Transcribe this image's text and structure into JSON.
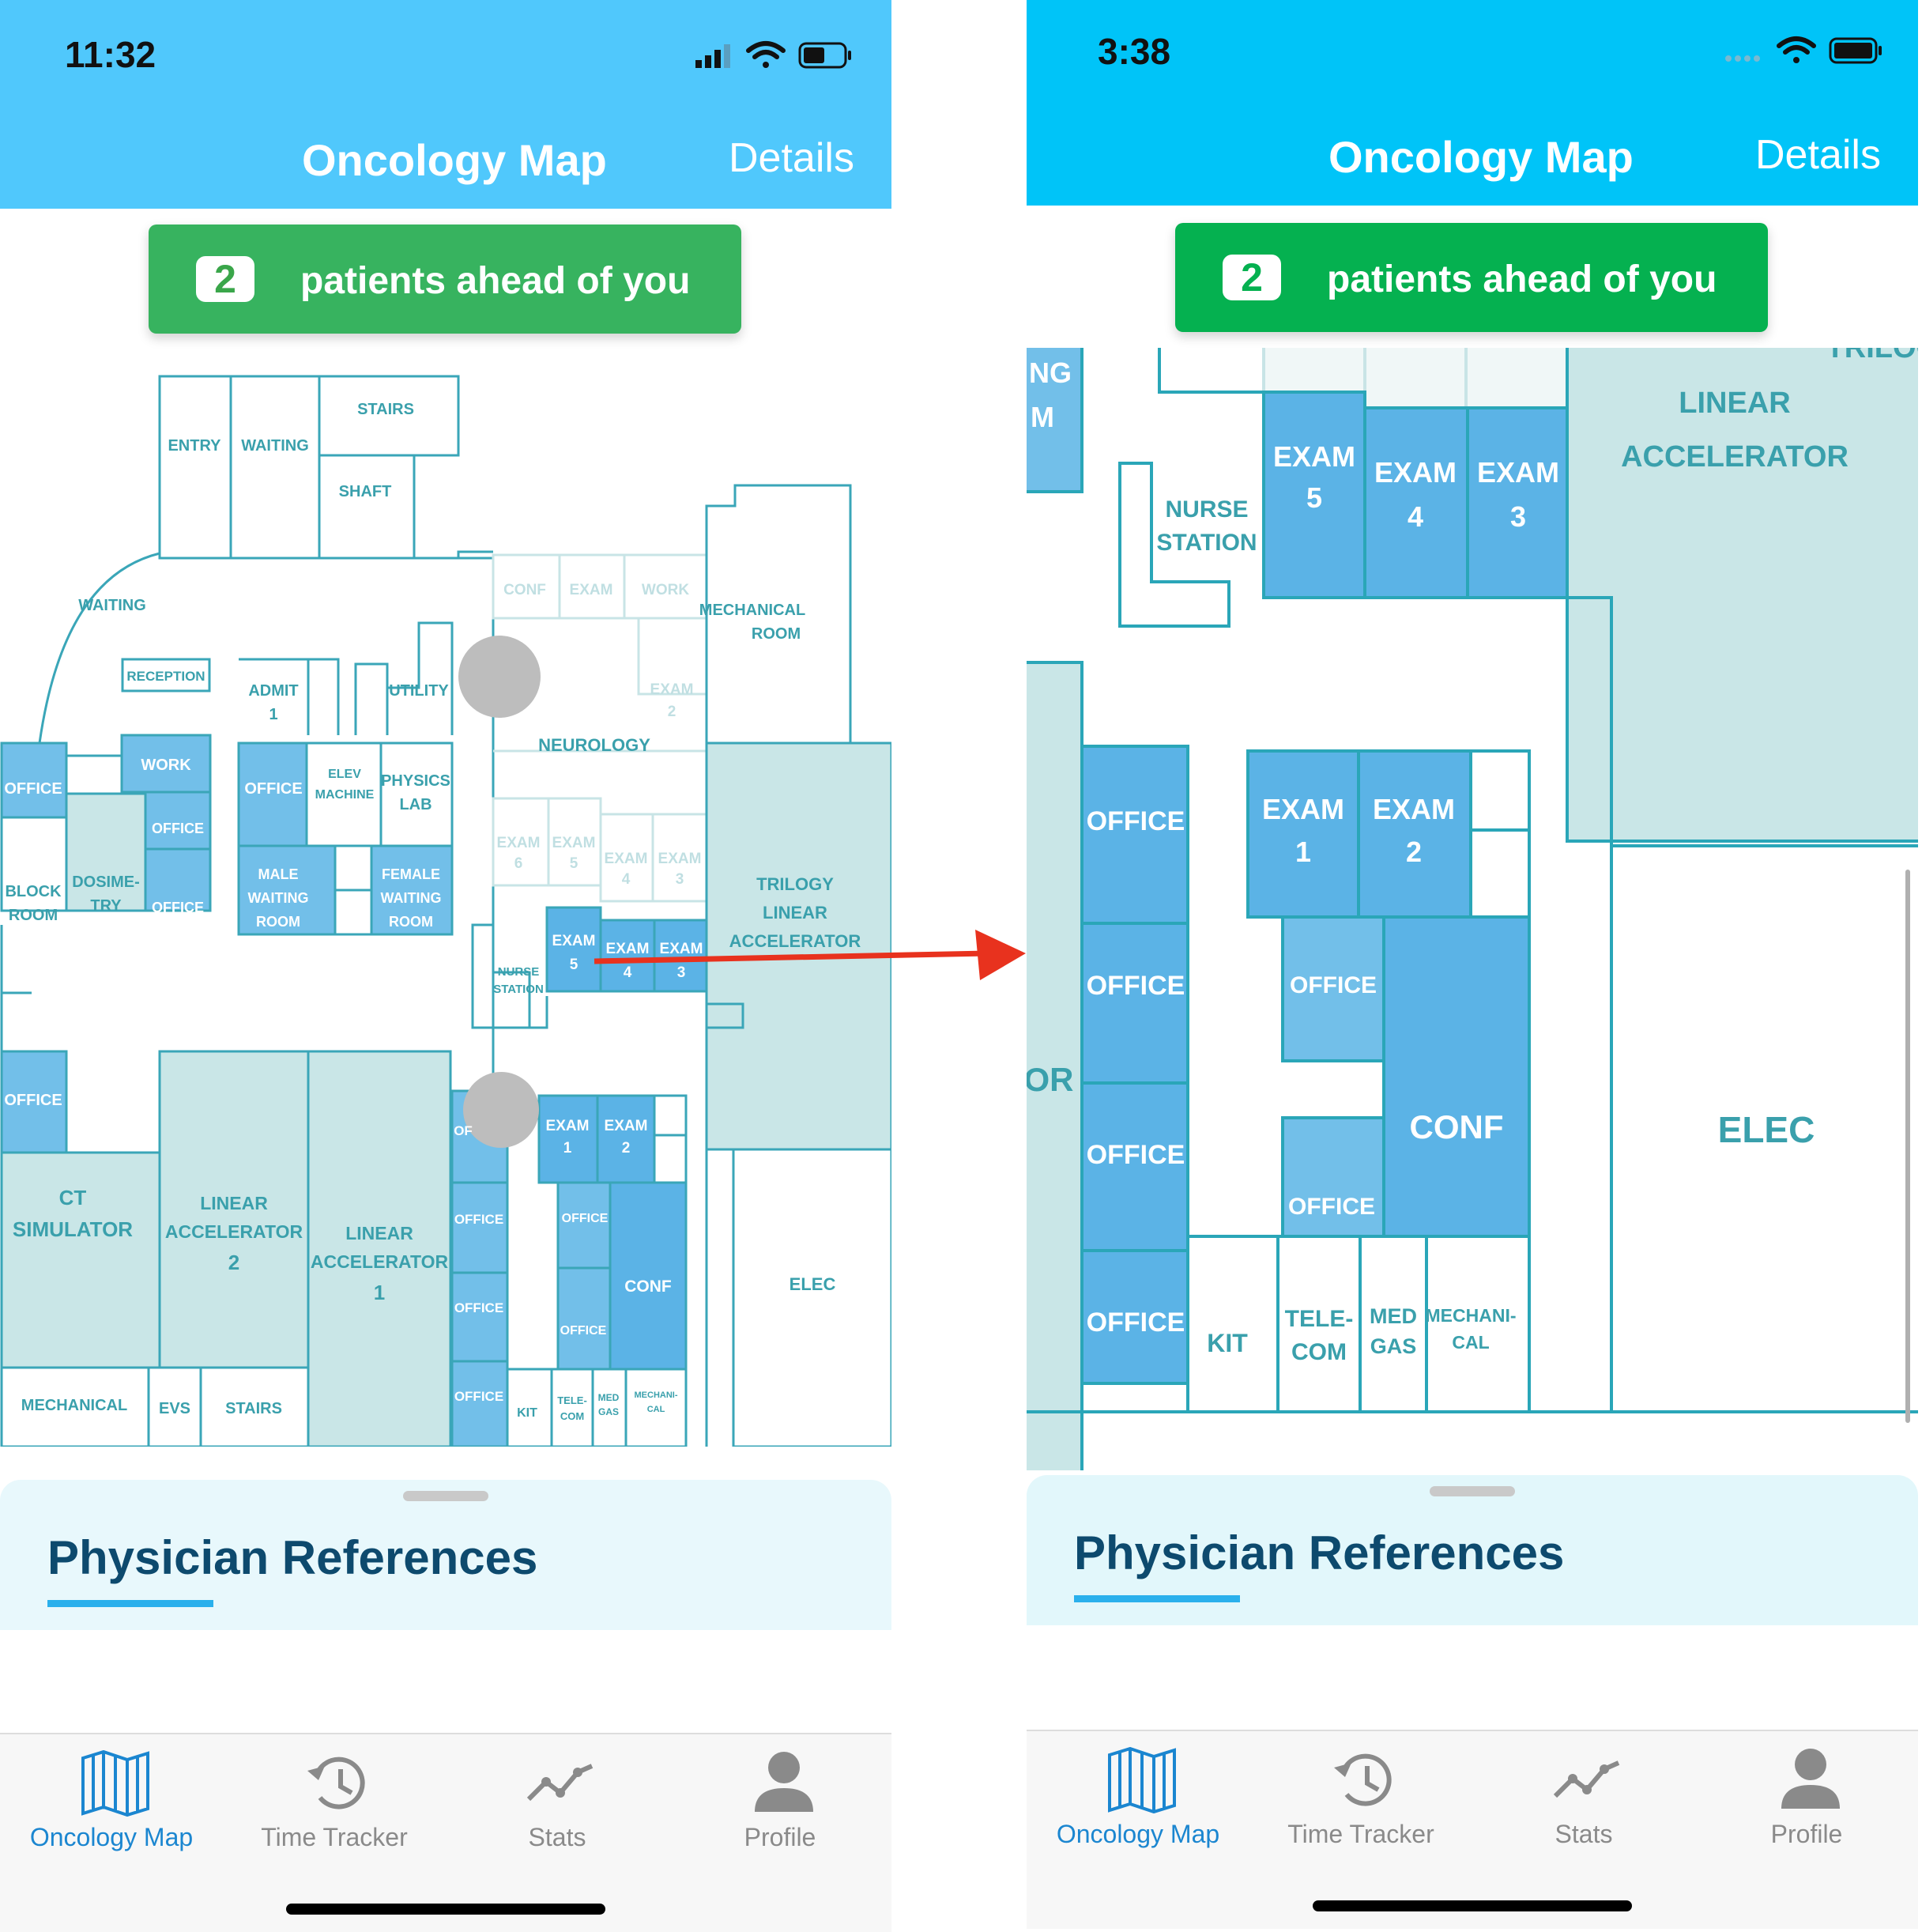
{
  "left_screen": {
    "status_time": "11:32",
    "nav_title": "Oncology Map",
    "nav_action": "Details",
    "queue_count": "2",
    "queue_text": "patients ahead of you",
    "sheet_title": "Physician References",
    "tabs": [
      {
        "label": "Oncology Map",
        "icon": "map-icon",
        "active": true
      },
      {
        "label": "Time Tracker",
        "icon": "history-icon",
        "active": false
      },
      {
        "label": "Stats",
        "icon": "stats-icon",
        "active": false
      },
      {
        "label": "Profile",
        "icon": "person-icon",
        "active": false
      }
    ],
    "map_labels": {
      "stairs_top": "STAIRS",
      "entry": "ENTRY",
      "waiting_top": "WAITING",
      "shaft": "SHAFT",
      "waiting": "WAITING",
      "reception": "RECEPTION",
      "admit": "ADMIT",
      "admit_num": "1",
      "utility": "UTILITY",
      "conf": "CONF",
      "exam": "EXAM",
      "work": "WORK",
      "mechanical_room_1": "MECHANICAL",
      "mechanical_room_2": "ROOM",
      "exam2_a": "EXAM",
      "exam2_b": "2",
      "neurology": "NEUROLOGY",
      "office_1": "OFFICE",
      "work_2": "WORK",
      "elev_1": "ELEV",
      "elev_2": "MACHINE",
      "physics_1": "PHYSICS",
      "physics_2": "LAB",
      "office_2": "OFFICE",
      "office_3": "OFFICE",
      "block_1": "BLOCK",
      "block_2": "ROOM",
      "dosimetry_1": "DOSIME-",
      "dosimetry_2": "TRY",
      "office_4": "OFFICE",
      "male_1": "MALE",
      "male_2": "WAITING",
      "male_3": "ROOM",
      "female_1": "FEMALE",
      "female_2": "WAITING",
      "female_3": "ROOM",
      "exam6_a": "EXAM",
      "exam6_b": "6",
      "exam5f_a": "EXAM",
      "exam5f_b": "5",
      "exam4f_a": "EXAM",
      "exam4f_b": "4",
      "exam3f_a": "EXAM",
      "exam3f_b": "3",
      "trilogy_1": "TRILOGY",
      "trilogy_2": "LINEAR",
      "trilogy_3": "ACCELERATOR",
      "exam5_a": "EXAM",
      "exam5_b": "5",
      "exam4_a": "EXAM",
      "exam4_b": "4",
      "exam3_a": "EXAM",
      "exam3_b": "3",
      "nurse_1": "NURSE",
      "nurse_2": "STATION",
      "office_5": "OFFICE",
      "ct_1": "CT",
      "ct_2": "SIMULATOR",
      "lin2_1": "LINEAR",
      "lin2_2": "ACCELERATOR",
      "lin2_3": "2",
      "lin1_1": "LINEAR",
      "lin1_2": "ACCELERATOR",
      "lin1_3": "1",
      "office_of": "OF",
      "exam1_a": "EXAM",
      "exam1_b": "1",
      "exam2s_a": "EXAM",
      "exam2s_b": "2",
      "office_6": "OFFICE",
      "office_7": "OFFICE",
      "conf_2": "CONF",
      "office_8": "OFFICE",
      "office_9": "OFFICE",
      "office_10": "OFFICE",
      "kit": "KIT",
      "tele_1": "TELE-",
      "tele_2": "COM",
      "med_1": "MED",
      "med_2": "GAS",
      "mech_1": "MECHANI-",
      "mech_2": "CAL",
      "mechanical": "MECHANICAL",
      "evs": "EVS",
      "stairs": "STAIRS",
      "elec": "ELEC"
    }
  },
  "right_screen": {
    "status_time": "3:38",
    "nav_title": "Oncology Map",
    "nav_action": "Details",
    "queue_count": "2",
    "queue_text": "patients ahead of you",
    "sheet_title": "Physician References",
    "tabs": [
      {
        "label": "Oncology Map",
        "icon": "map-icon",
        "active": true
      },
      {
        "label": "Time Tracker",
        "icon": "history-icon",
        "active": false
      },
      {
        "label": "Stats",
        "icon": "stats-icon",
        "active": false
      },
      {
        "label": "Profile",
        "icon": "person-icon",
        "active": false
      }
    ],
    "map_labels": {
      "ng": "NG",
      "m": "M",
      "trilogy_1": "TRILOGY",
      "trilogy_2": "LINEAR",
      "trilogy_3": "ACCELERATOR",
      "exam5_a": "EXAM",
      "exam5_b": "5",
      "exam4_a": "EXAM",
      "exam4_b": "4",
      "exam3_a": "EXAM",
      "exam3_b": "3",
      "nurse_1": "NURSE",
      "nurse_2": "STATION",
      "office_1": "OFFICE",
      "exam1_a": "EXAM",
      "exam1_b": "1",
      "exam2_a": "EXAM",
      "exam2_b": "2",
      "office_2": "OFFICE",
      "office_3": "OFFICE",
      "or": "OR",
      "conf": "CONF",
      "office_4": "OFFICE",
      "office_5": "OFFICE",
      "office_6": "OFFICE",
      "elec": "ELEC",
      "kit": "KIT",
      "tele_1": "TELE-",
      "tele_2": "COM",
      "med_1": "MED",
      "med_2": "GAS",
      "mech_1": "MECHANI-",
      "mech_2": "CAL"
    }
  },
  "colors": {
    "header_left": "#50c8fc",
    "header_right": "#00c4f8",
    "pill_left": "#37b35f",
    "pill_right": "#05b150",
    "wall": "#2aa6b8",
    "room_blue": "#72bfe9",
    "room_blue_dark": "#5bb3e6",
    "room_teal": "#c8e6e6",
    "label_teal": "#3aa0ac",
    "sheet_bg": "#e8f8fc",
    "tab_active": "#1b86d0",
    "arrow": "#e8321e"
  }
}
